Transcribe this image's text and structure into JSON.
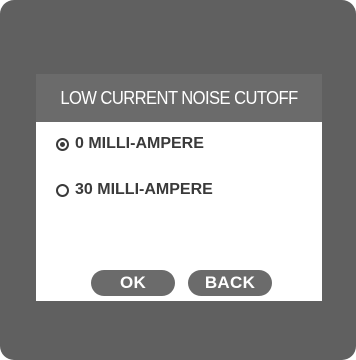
{
  "dialog": {
    "title": "LOW CURRENT NOISE CUTOFF",
    "options": [
      {
        "label": "0 MILLI-AMPERE",
        "selected": true
      },
      {
        "label": "30 MILLI-AMPERE",
        "selected": false
      }
    ],
    "buttons": {
      "ok_label": "OK",
      "back_label": "BACK"
    }
  },
  "colors": {
    "screen_background": "#606060",
    "header_background": "#6b6b6b",
    "dialog_background": "#ffffff",
    "text_dark": "#3a3a3a",
    "text_light": "#ffffff"
  }
}
